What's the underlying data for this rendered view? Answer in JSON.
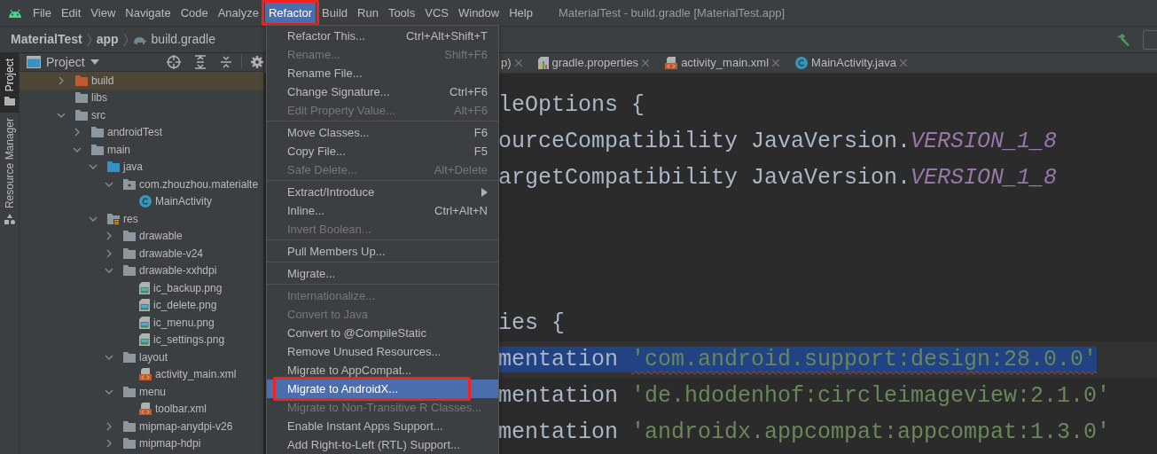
{
  "menubar": {
    "items": [
      {
        "label": "File",
        "selected": false,
        "outlined": false
      },
      {
        "label": "Edit",
        "selected": false,
        "outlined": false
      },
      {
        "label": "View",
        "selected": false,
        "outlined": false
      },
      {
        "label": "Navigate",
        "selected": false,
        "outlined": false
      },
      {
        "label": "Code",
        "selected": false,
        "outlined": false
      },
      {
        "label": "Analyze",
        "selected": false,
        "outlined": false
      },
      {
        "label": "Refactor",
        "selected": true,
        "outlined": true
      },
      {
        "label": "Build",
        "selected": false,
        "outlined": false
      },
      {
        "label": "Run",
        "selected": false,
        "outlined": false
      },
      {
        "label": "Tools",
        "selected": false,
        "outlined": false
      },
      {
        "label": "VCS",
        "selected": false,
        "outlined": false
      },
      {
        "label": "Window",
        "selected": false,
        "outlined": false
      },
      {
        "label": "Help",
        "selected": false,
        "outlined": false
      }
    ],
    "title": "MaterialTest - build.gradle [MaterialTest.app]"
  },
  "breadcrumb": [
    {
      "label": "MaterialTest",
      "kind": "project"
    },
    {
      "label": "app",
      "kind": "module"
    },
    {
      "label": "build.gradle",
      "kind": "gradle"
    }
  ],
  "tool_stripe": [
    {
      "label": "Project",
      "selected": true
    },
    {
      "label": "Resource Manager",
      "selected": false
    }
  ],
  "project_panel": {
    "title": "Project",
    "tree": [
      {
        "name": "build",
        "kind": "folder-excluded",
        "expanded": false,
        "selected": true
      },
      {
        "name": "libs",
        "kind": "folder",
        "selected": false
      },
      {
        "name": "src",
        "kind": "folder",
        "expanded": true,
        "selected": false,
        "children": [
          {
            "name": "androidTest",
            "kind": "folder",
            "expanded": false,
            "selected": false
          },
          {
            "name": "main",
            "kind": "folder",
            "expanded": true,
            "selected": false,
            "children": [
              {
                "name": "java",
                "kind": "folder-source",
                "expanded": true,
                "selected": false,
                "children": [
                  {
                    "name": "com.zhouzhou.materialte",
                    "kind": "package",
                    "expanded": true,
                    "selected": false,
                    "children": [
                      {
                        "name": "MainActivity",
                        "kind": "class",
                        "selected": false
                      }
                    ]
                  }
                ]
              },
              {
                "name": "res",
                "kind": "folder-res",
                "expanded": true,
                "selected": false,
                "children": [
                  {
                    "name": "drawable",
                    "kind": "folder",
                    "expanded": false,
                    "selected": false
                  },
                  {
                    "name": "drawable-v24",
                    "kind": "folder",
                    "expanded": false,
                    "selected": false
                  },
                  {
                    "name": "drawable-xxhdpi",
                    "kind": "folder",
                    "expanded": true,
                    "selected": false,
                    "children": [
                      {
                        "name": "ic_backup.png",
                        "kind": "image",
                        "selected": false
                      },
                      {
                        "name": "ic_delete.png",
                        "kind": "image",
                        "selected": false
                      },
                      {
                        "name": "ic_menu.png",
                        "kind": "image",
                        "selected": false
                      },
                      {
                        "name": "ic_settings.png",
                        "kind": "image",
                        "selected": false
                      }
                    ]
                  },
                  {
                    "name": "layout",
                    "kind": "folder",
                    "expanded": true,
                    "selected": false,
                    "children": [
                      {
                        "name": "activity_main.xml",
                        "kind": "xml",
                        "selected": false
                      }
                    ]
                  },
                  {
                    "name": "menu",
                    "kind": "folder",
                    "expanded": true,
                    "selected": false,
                    "children": [
                      {
                        "name": "toolbar.xml",
                        "kind": "xml",
                        "selected": false
                      }
                    ]
                  },
                  {
                    "name": "mipmap-anydpi-v26",
                    "kind": "folder",
                    "expanded": false,
                    "selected": false
                  },
                  {
                    "name": "mipmap-hdpi",
                    "kind": "folder",
                    "expanded": false,
                    "selected": false
                  }
                ]
              }
            ]
          }
        ]
      }
    ]
  },
  "editor_tabs": [
    {
      "label": "p)",
      "kind": "plain"
    },
    {
      "label": "gradle.properties",
      "kind": "properties"
    },
    {
      "label": "activity_main.xml",
      "kind": "xml"
    },
    {
      "label": "MainActivity.java",
      "kind": "class"
    }
  ],
  "code": {
    "blocks": [
      [
        {
          "selected": false,
          "tokens": [
            {
              "kind": "plain",
              "text": "leOptions {"
            }
          ]
        },
        {
          "selected": false,
          "tokens": [
            {
              "kind": "plain",
              "text": "ourceCompatibility JavaVersion."
            },
            {
              "kind": "constant",
              "text": "VERSION_1_8"
            }
          ]
        },
        {
          "selected": false,
          "tokens": [
            {
              "kind": "plain",
              "text": "argetCompatibility JavaVersion."
            },
            {
              "kind": "constant",
              "text": "VERSION_1_8"
            }
          ]
        }
      ],
      [
        {
          "selected": false,
          "tokens": [
            {
              "kind": "plain",
              "text": "ies {"
            }
          ]
        },
        {
          "selected": true,
          "tokens": [
            {
              "kind": "plain",
              "text": "mentation "
            },
            {
              "kind": "string-error",
              "text": "'com.android.support:design:28.0.0'"
            }
          ]
        },
        {
          "selected": false,
          "tokens": [
            {
              "kind": "plain",
              "text": "mentation "
            },
            {
              "kind": "string",
              "text": "'de.hdodenhof:circleimageview:2.1.0'"
            }
          ]
        },
        {
          "selected": false,
          "tokens": [
            {
              "kind": "plain",
              "text": "mentation "
            },
            {
              "kind": "string",
              "text": "'androidx.appcompat:appcompat:1.3.0'"
            }
          ]
        }
      ]
    ]
  },
  "refactor_menu": [
    {
      "kind": "item",
      "label": "Refactor This...",
      "shortcut": "Ctrl+Alt+Shift+T",
      "disabled": false,
      "selected": false,
      "submenu": false,
      "outlined": false
    },
    {
      "kind": "item",
      "label": "Rename...",
      "shortcut": "Shift+F6",
      "disabled": true,
      "selected": false,
      "submenu": false,
      "outlined": false
    },
    {
      "kind": "item",
      "label": "Rename File...",
      "disabled": false,
      "selected": false,
      "submenu": false,
      "outlined": false
    },
    {
      "kind": "item",
      "label": "Change Signature...",
      "shortcut": "Ctrl+F6",
      "disabled": false,
      "selected": false,
      "submenu": false,
      "outlined": false
    },
    {
      "kind": "item",
      "label": "Edit Property Value...",
      "shortcut": "Alt+F6",
      "disabled": true,
      "selected": false,
      "submenu": false,
      "outlined": false
    },
    {
      "kind": "separator"
    },
    {
      "kind": "item",
      "label": "Move Classes...",
      "shortcut": "F6",
      "disabled": false,
      "selected": false,
      "submenu": false,
      "outlined": false
    },
    {
      "kind": "item",
      "label": "Copy File...",
      "shortcut": "F5",
      "disabled": false,
      "selected": false,
      "submenu": false,
      "outlined": false
    },
    {
      "kind": "item",
      "label": "Safe Delete...",
      "shortcut": "Alt+Delete",
      "disabled": true,
      "selected": false,
      "submenu": false,
      "outlined": false
    },
    {
      "kind": "separator"
    },
    {
      "kind": "item",
      "label": "Extract/Introduce",
      "disabled": false,
      "selected": false,
      "submenu": true,
      "outlined": false
    },
    {
      "kind": "item",
      "label": "Inline...",
      "shortcut": "Ctrl+Alt+N",
      "disabled": false,
      "selected": false,
      "submenu": false,
      "outlined": false
    },
    {
      "kind": "item",
      "label": "Invert Boolean...",
      "disabled": true,
      "selected": false,
      "submenu": false,
      "outlined": false
    },
    {
      "kind": "separator"
    },
    {
      "kind": "item",
      "label": "Pull Members Up...",
      "disabled": false,
      "selected": false,
      "submenu": false,
      "outlined": false
    },
    {
      "kind": "separator"
    },
    {
      "kind": "item",
      "label": "Migrate...",
      "disabled": false,
      "selected": false,
      "submenu": false,
      "outlined": false
    },
    {
      "kind": "separator"
    },
    {
      "kind": "item",
      "label": "Internationalize...",
      "disabled": true,
      "selected": false,
      "submenu": false,
      "outlined": false
    },
    {
      "kind": "item",
      "label": "Convert to Java",
      "disabled": true,
      "selected": false,
      "submenu": false,
      "outlined": false
    },
    {
      "kind": "item",
      "label": "Convert to @CompileStatic",
      "disabled": false,
      "selected": false,
      "submenu": false,
      "outlined": false
    },
    {
      "kind": "item",
      "label": "Remove Unused Resources...",
      "disabled": false,
      "selected": false,
      "submenu": false,
      "outlined": false
    },
    {
      "kind": "item",
      "label": "Migrate to AppCompat...",
      "disabled": false,
      "selected": false,
      "submenu": false,
      "outlined": false
    },
    {
      "kind": "item",
      "label": "Migrate to AndroidX...",
      "disabled": false,
      "selected": true,
      "submenu": false,
      "outlined": true
    },
    {
      "kind": "item",
      "label": "Migrate to Non-Transitive R Classes...",
      "disabled": true,
      "selected": false,
      "submenu": false,
      "outlined": false
    },
    {
      "kind": "item",
      "label": "Enable Instant Apps Support...",
      "disabled": false,
      "selected": false,
      "submenu": false,
      "outlined": false
    },
    {
      "kind": "item",
      "label": "Add Right-to-Left (RTL) Support...",
      "disabled": false,
      "selected": false,
      "submenu": false,
      "outlined": false
    }
  ]
}
